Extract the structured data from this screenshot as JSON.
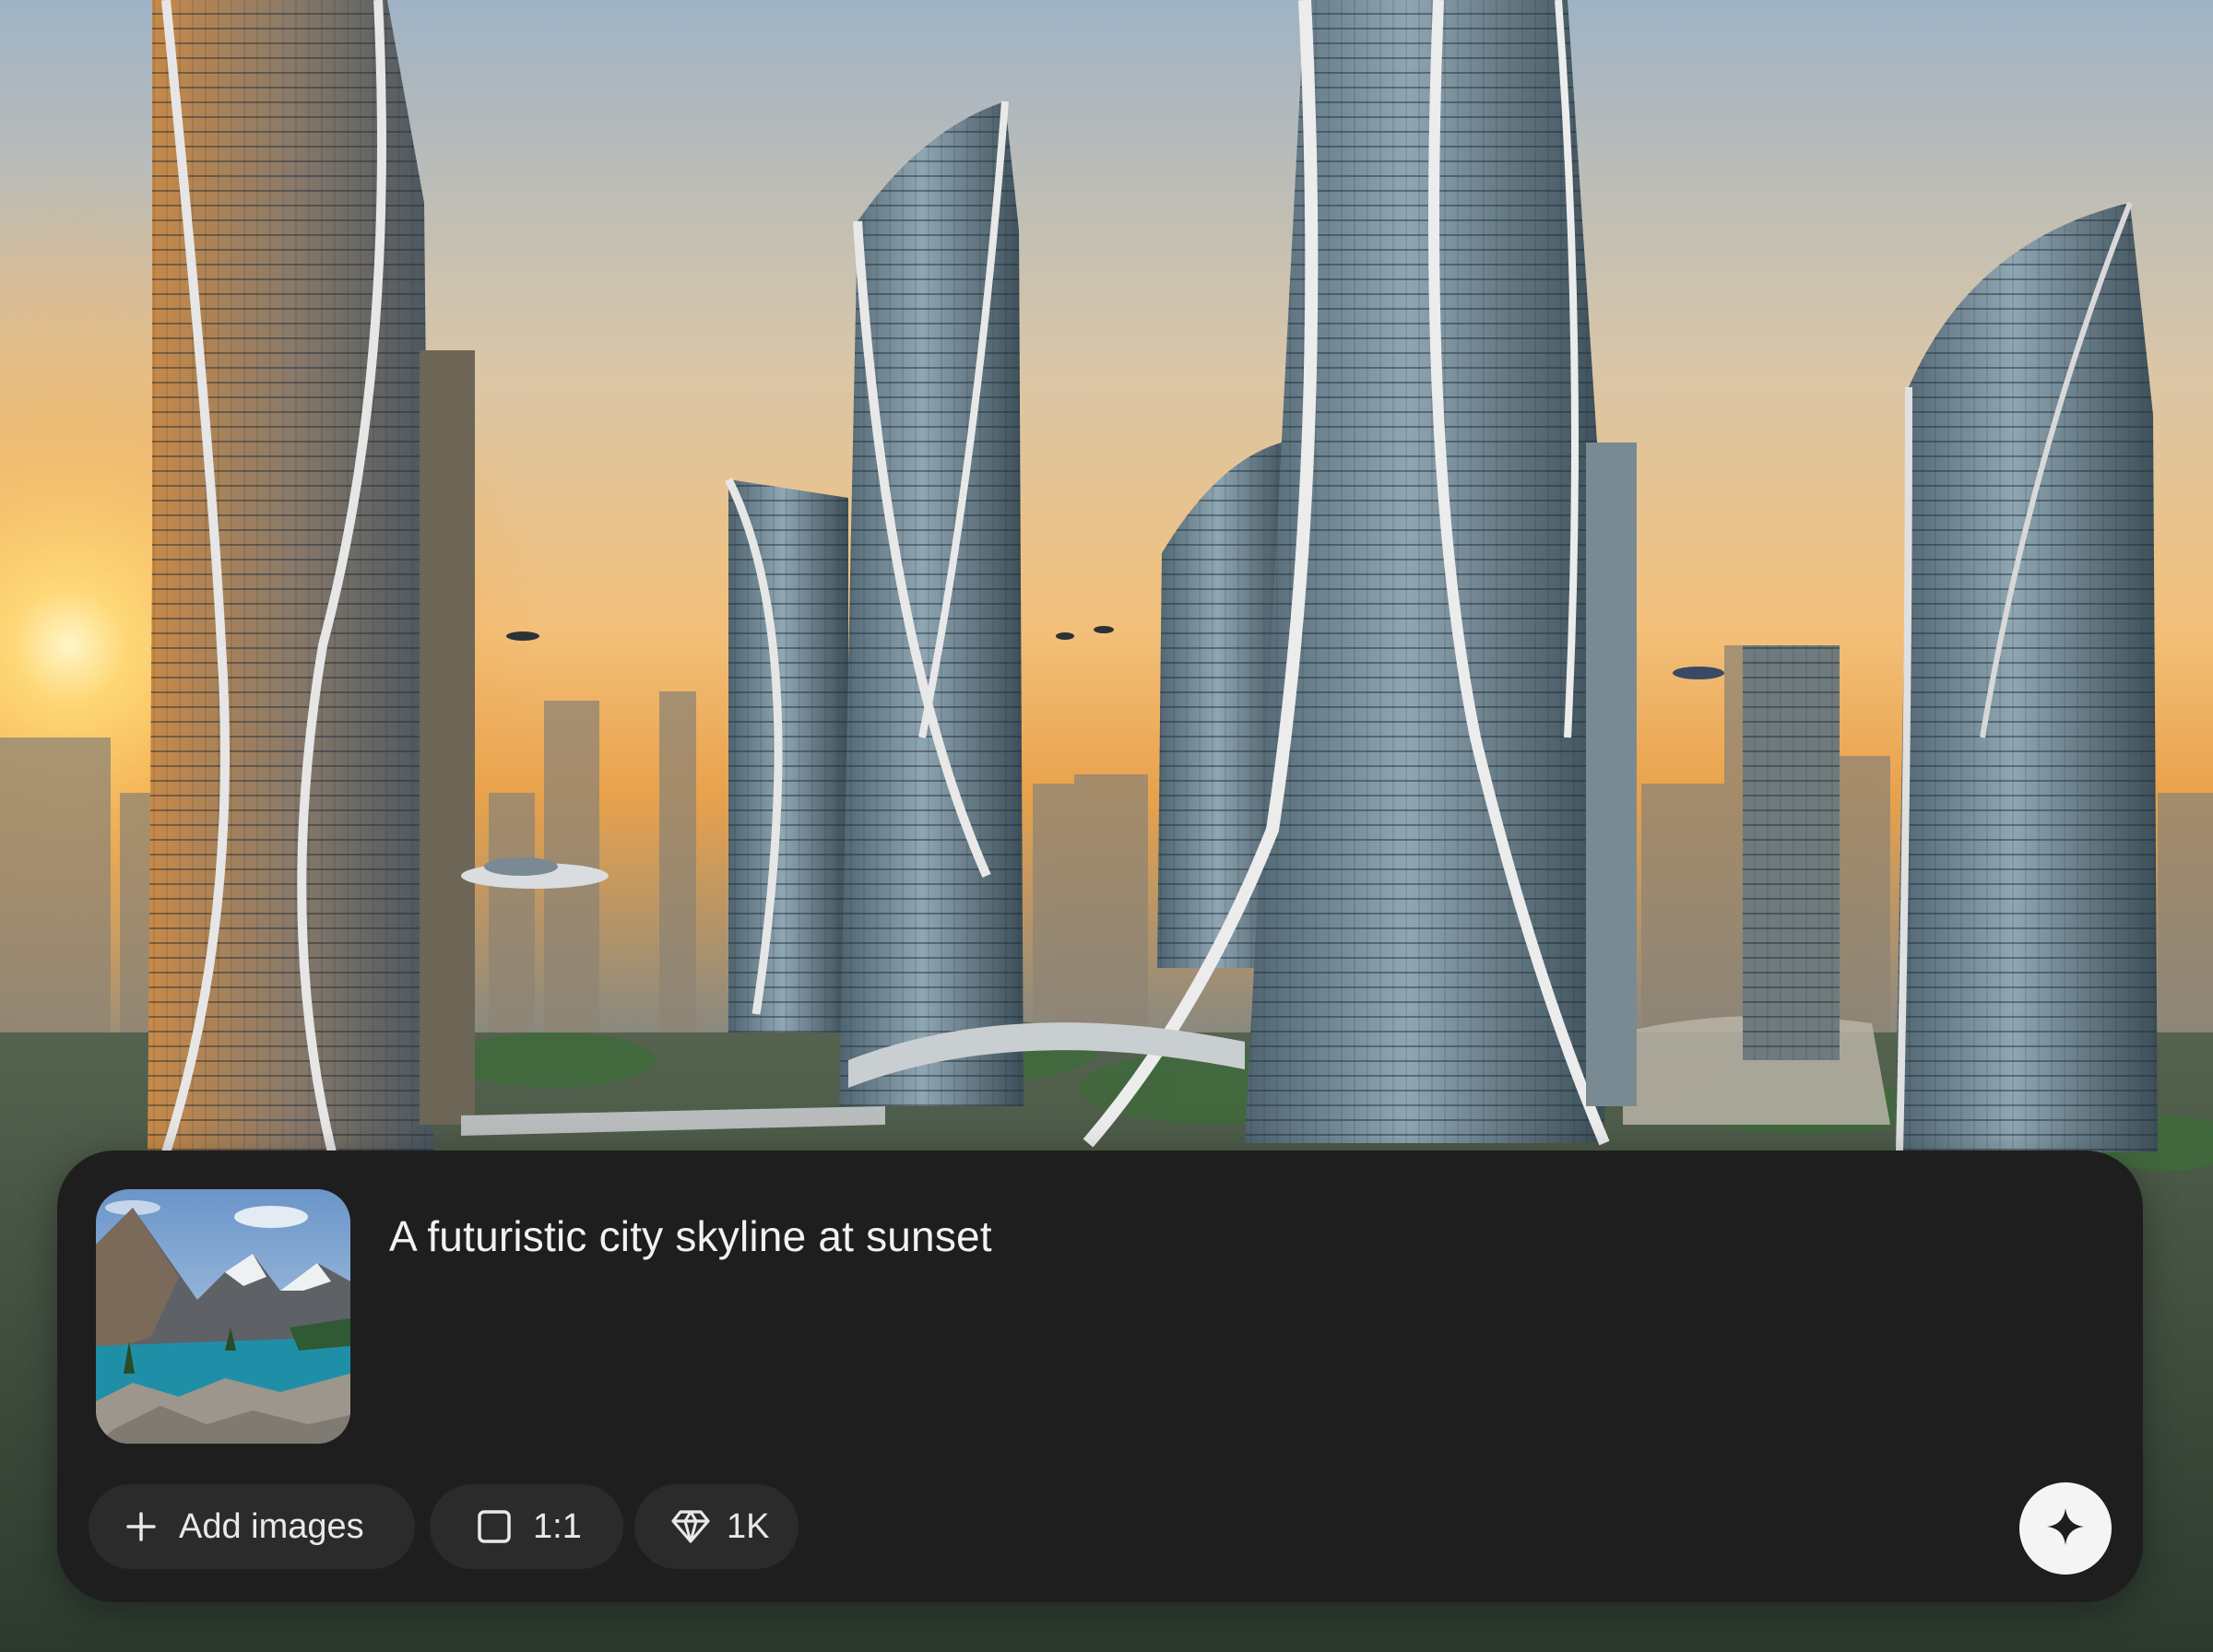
{
  "prompt": {
    "text": "A futuristic city skyline at sunset",
    "reference_image_icon": "mountain-lake-thumbnail"
  },
  "toolbar": {
    "add_images_label": "Add images",
    "add_images_icon": "plus-icon",
    "aspect_ratio_label": "1:1",
    "aspect_ratio_icon": "square-icon",
    "resolution_label": "1K",
    "resolution_icon": "diamond-icon",
    "generate_icon": "sparkle-icon"
  },
  "colors": {
    "panel_bg": "#1f1e1e",
    "chip_bg": "#2c2b2b",
    "text": "#f2f2f2",
    "generate_bg": "#f4f4f4"
  }
}
